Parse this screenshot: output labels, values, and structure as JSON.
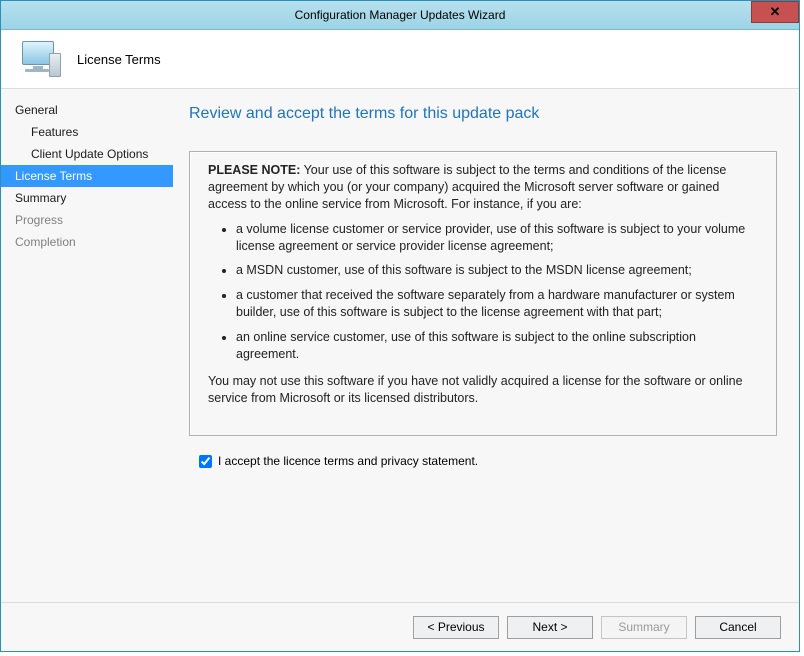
{
  "window": {
    "title": "Configuration Manager Updates Wizard"
  },
  "header": {
    "label": "License Terms"
  },
  "sidebar": {
    "items": [
      {
        "label": "General",
        "indent": false,
        "selected": false,
        "disabled": false
      },
      {
        "label": "Features",
        "indent": true,
        "selected": false,
        "disabled": false
      },
      {
        "label": "Client Update Options",
        "indent": true,
        "selected": false,
        "disabled": false
      },
      {
        "label": "License Terms",
        "indent": false,
        "selected": true,
        "disabled": false
      },
      {
        "label": "Summary",
        "indent": false,
        "selected": false,
        "disabled": false
      },
      {
        "label": "Progress",
        "indent": false,
        "selected": false,
        "disabled": true
      },
      {
        "label": "Completion",
        "indent": false,
        "selected": false,
        "disabled": true
      }
    ]
  },
  "main": {
    "pageTitle": "Review and accept the terms for this update pack",
    "noteLabel": "PLEASE NOTE:",
    "noteIntro": " Your use of this software is subject to the terms and conditions of the license agreement by which you (or your company) acquired the Microsoft server software or gained access to the online service from Microsoft. For instance, if you are:",
    "bullets": [
      "a volume license customer or service provider, use of this software is subject to your volume license agreement or service provider license agreement;",
      "a MSDN customer, use of this software is subject to the MSDN license agreement;",
      "a customer that received the software separately from a hardware manufacturer or system builder, use of this software is subject to the license agreement with that part;",
      "an online service customer, use of this software is subject to the online subscription agreement."
    ],
    "noteFooter": "You may not use this software if you have not validly acquired a license for the software or online service from Microsoft or its licensed distributors.",
    "acceptLabel": "I accept the licence terms and privacy statement.",
    "acceptChecked": true
  },
  "footer": {
    "previous": "< Previous",
    "next": "Next >",
    "summary": "Summary",
    "cancel": "Cancel"
  }
}
